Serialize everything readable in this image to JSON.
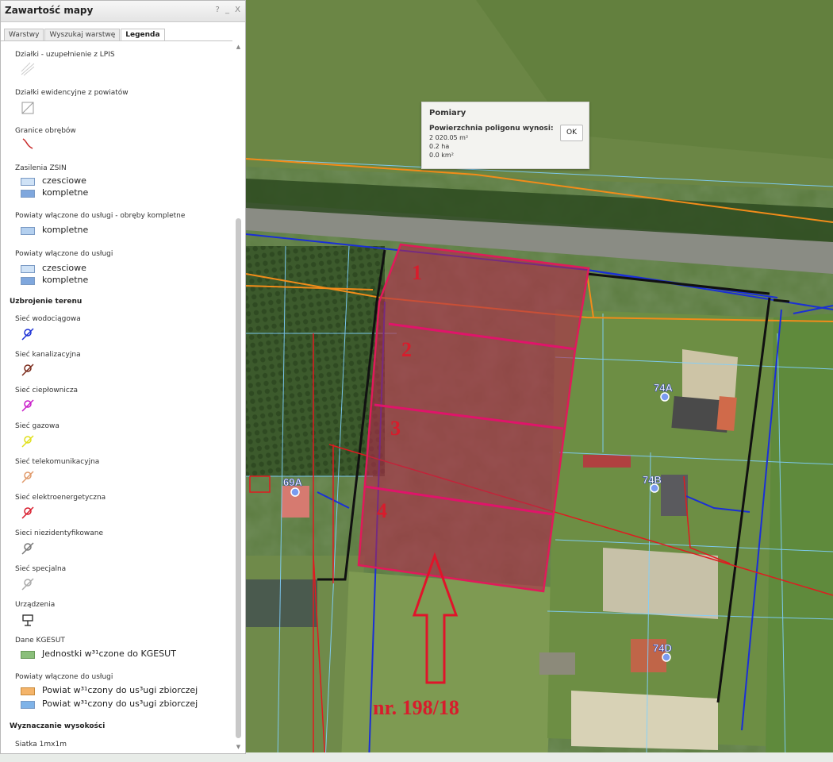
{
  "panel": {
    "title": "Zawartość mapy",
    "buttons": [
      "?",
      "_",
      "X"
    ],
    "tabs": [
      "Warstwy",
      "Wyszukaj warstwę",
      "Legenda"
    ],
    "active_tab": "Legenda"
  },
  "legend": {
    "lpis": "Działki - uzupełnienie z LPIS",
    "ewid": "Działki ewidencyjne z powiatów",
    "granice": "Granice obrębów",
    "zsin": "Zasilenia ZSIN",
    "zsin_czesciowe": "czesciowe",
    "zsin_kompletne": "kompletne",
    "pow_obreby": "Powiaty włączone do usługi - obręby kompletne",
    "pow_obreby_kompletne": "kompletne",
    "pow_uslugi": "Powiaty włączone do usługi",
    "pow_uslugi_czesciowe": "czesciowe",
    "pow_uslugi_kompletne": "kompletne",
    "uzbrojenie": "Uzbrojenie terenu",
    "wodociag": "Sieć wodociągowa",
    "kanalizacja": "Sieć kanalizacyjna",
    "cieplo": "Sieć ciepłownicza",
    "gaz": "Sieć gazowa",
    "telekom": "Sieć telekomunikacyjna",
    "elektro": "Sieć elektroenergetyczna",
    "niezident": "Sieci niezidentyfikowane",
    "specjalna": "Sieć specjalna",
    "urzadzenia": "Urządzenia",
    "kgesut": "Dane KGESUT",
    "kgesut_item": "Jednostki w³¹czone do KGESUT",
    "pow_uslugi2": "Powiaty włączone do usługi",
    "pow_zbiorczej_1": "Powiat w³¹czony do us³ugi zbiorczej",
    "pow_zbiorczej_2": "Powiat w³¹czony do us³ugi zbiorczej",
    "wysokosci": "Wyznaczanie wysokości",
    "siatka": "Siatka 1mx1m"
  },
  "popup": {
    "title": "Pomiary",
    "subtitle": "Powierzchnia poligonu wynosi:",
    "m2": "2 020.05 m²",
    "ha": "0.2 ha",
    "km2": "0.0 km²",
    "ok": "OK"
  },
  "map": {
    "addresses": [
      "74A",
      "74B",
      "74D",
      "69A"
    ],
    "plots": [
      "1",
      "2",
      "3",
      "4"
    ],
    "parcel_label": "nr. 198/18"
  },
  "colors": {
    "highlight": "#d81c2c",
    "parcel_fill": "#b02a4a",
    "water_line": "#1a2fd6",
    "gas_line": "#f28c1a",
    "boundary": "#111111"
  }
}
